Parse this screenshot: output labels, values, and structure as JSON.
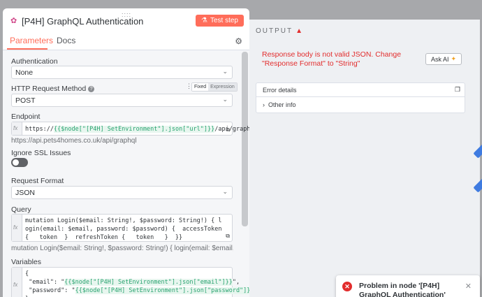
{
  "node": {
    "title": "[P4H] GraphQL Authentication",
    "test_step_label": "Test step",
    "drag_handle": "::::"
  },
  "tabs": [
    {
      "label": "Parameters",
      "active": true
    },
    {
      "label": "Docs",
      "active": false
    }
  ],
  "params": {
    "authentication": {
      "label": "Authentication",
      "value": "None"
    },
    "method": {
      "label": "HTTP Request Method",
      "value": "POST",
      "fixed_label": "Fixed",
      "expression_label": "Expression"
    },
    "endpoint": {
      "label": "Endpoint",
      "prefix": "https://",
      "token": "{{$node[\"[P4H] SetEnvironment\"].json[\"url\"]}}",
      "suffix": "/api/graphql",
      "resolved": "https://api.pets4homes.co.uk/api/graphql"
    },
    "ssl": {
      "label": "Ignore SSL Issues"
    },
    "format": {
      "label": "Request Format",
      "value": "JSON"
    },
    "query": {
      "label": "Query",
      "value": "mutation Login($email: String!, $password: String!) { login(email: $email, password: $password) {  accessToken {   token  }  refreshToken {   token   }  }}",
      "resolved": "mutation Login($email: String!, $password: String!) { login(email: $email, password: $passwo..."
    },
    "variables": {
      "label": "Variables",
      "line1": "{",
      "line2_key": " \"email\": \"",
      "line2_token": "{{$node[\"[P4H] SetEnvironment\"].json[\"email\"]}}",
      "line2_end": "\",",
      "line3_key": " \"password\": \"",
      "line3_token": "{{$node[\"[P4H] SetEnvironment\"].json[\"password\"]}}",
      "line3_end": "\"",
      "line4": "}"
    }
  },
  "output": {
    "title": "OUTPUT",
    "error_message": "Response body is not valid JSON. Change \"Response Format\" to \"String\"",
    "ask_ai_label": "Ask AI",
    "details_title": "Error details",
    "other_info": "Other info"
  },
  "toast": {
    "message": "Problem in node '[P4H] GraphQL Authentication'"
  },
  "colors": {
    "accent": "#ff6d5a",
    "error": "#e22d2d",
    "expression_token": "#28a36f"
  }
}
